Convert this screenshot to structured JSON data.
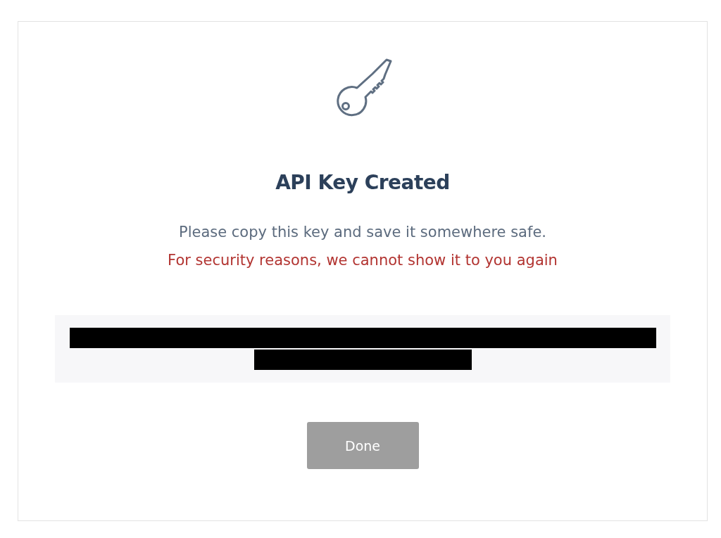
{
  "dialog": {
    "title": "API Key Created",
    "message": "Please copy this key and save it somewhere safe.",
    "warning": "For security reasons, we cannot show it to you again",
    "key_redacted": true,
    "button": {
      "label": "Done",
      "disabled": true
    }
  }
}
